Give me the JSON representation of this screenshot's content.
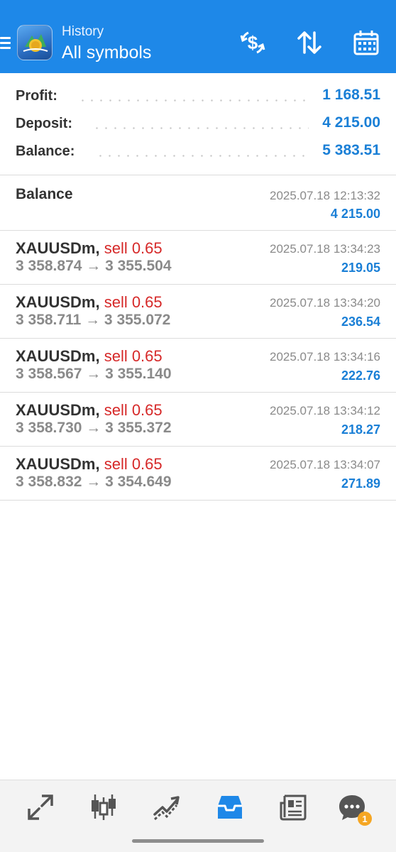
{
  "header": {
    "subtitle": "History",
    "title": "All symbols"
  },
  "summary": [
    {
      "label": "Profit:",
      "value": "1 168.51"
    },
    {
      "label": "Deposit:",
      "value": "4 215.00"
    },
    {
      "label": "Balance:",
      "value": "5 383.51"
    }
  ],
  "balance_entry": {
    "title": "Balance",
    "time": "2025.07.18 12:13:32",
    "amount": "4 215.00"
  },
  "deals": [
    {
      "symbol": "XAUUSDm,",
      "action": "sell 0.65",
      "prices": "3 358.874 → 3 355.504",
      "time": "2025.07.18 13:34:23",
      "profit": "219.05"
    },
    {
      "symbol": "XAUUSDm,",
      "action": "sell 0.65",
      "prices": "3 358.711 → 3 355.072",
      "time": "2025.07.18 13:34:20",
      "profit": "236.54"
    },
    {
      "symbol": "XAUUSDm,",
      "action": "sell 0.65",
      "prices": "3 358.567 → 3 355.140",
      "time": "2025.07.18 13:34:16",
      "profit": "222.76"
    },
    {
      "symbol": "XAUUSDm,",
      "action": "sell 0.65",
      "prices": "3 358.730 → 3 355.372",
      "time": "2025.07.18 13:34:12",
      "profit": "218.27"
    },
    {
      "symbol": "XAUUSDm,",
      "action": "sell 0.65",
      "prices": "3 358.832 → 3 354.649",
      "time": "2025.07.18 13:34:07",
      "profit": "271.89"
    }
  ],
  "bottom_nav": {
    "items": [
      "quotes-icon",
      "chart-icon",
      "trade-icon",
      "history-icon",
      "news-icon",
      "chat-icon"
    ],
    "chat_badge": "1",
    "active": "history-icon"
  },
  "colors": {
    "header": "#1e88e8",
    "value_blue": "#1a7fd6",
    "sell_red": "#d62828",
    "muted_gray": "#8a8a8a"
  }
}
